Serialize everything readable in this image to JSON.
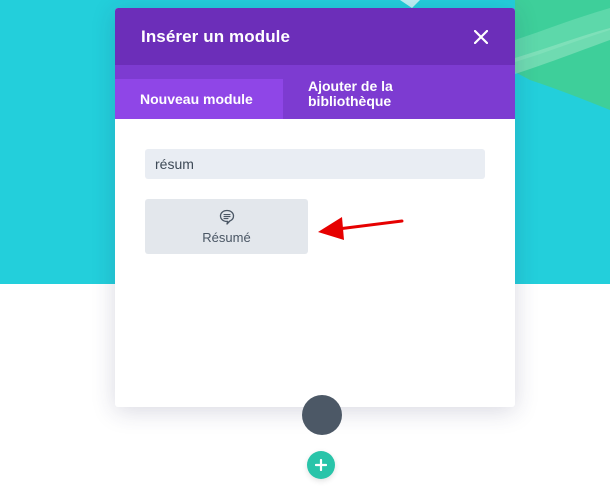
{
  "modal": {
    "title": "Insérer un module",
    "tabs": [
      {
        "label": "Nouveau module",
        "active": true
      },
      {
        "label": "Ajouter de la bibliothèque",
        "active": false
      }
    ]
  },
  "search": {
    "value": "résum"
  },
  "results": [
    {
      "label": "Résumé",
      "icon": "comment-icon"
    }
  ],
  "colors": {
    "hero_background": "#23cfdb",
    "modal_header": "#6c2eb9",
    "tab_bar": "#7d3bd1",
    "active_tab": "#8f46e7",
    "add_button": "#29c4a9",
    "arrow": "#e60000"
  },
  "icons": {
    "close": "close-icon",
    "add": "plus-icon"
  }
}
